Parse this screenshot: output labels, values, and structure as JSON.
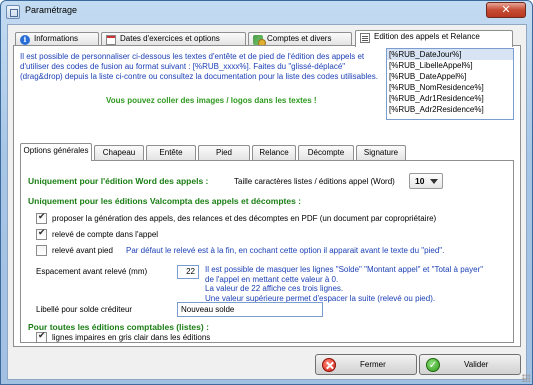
{
  "window": {
    "title": "Paramétrage",
    "close_symbol": "✕"
  },
  "top_tabs": [
    {
      "label": "Informations",
      "icon": "info-icon"
    },
    {
      "label": "Dates d'exercices et options",
      "icon": "calendar-icon"
    },
    {
      "label": "Comptes et divers",
      "icon": "accounts-icon"
    },
    {
      "label": "Edition des appels et Relance",
      "icon": "edition-icon"
    }
  ],
  "intro_text": "Il est possible de personnaliser ci-dessous les textes d'entête et de pied de l'édition des appels et d'utiliser des codes de fusion au format suivant : [%RUB_xxxx%]. Faites du \"glissé-déplacé\" (drag&drop) depuis la liste ci-contre ou consultez la documentation pour la liste des codes utilisables.",
  "paste_note": "Vous pouvez coller des images / logos dans les textes !",
  "merge_codes": [
    "[%RUB_DateJour%]",
    "[%RUB_LibelleAppel%]",
    "[%RUB_DateAppel%]",
    "[%RUB_NomResidence%]",
    "[%RUB_Adr1Residence%]",
    "[%RUB_Adr2Residence%]"
  ],
  "inner_tabs": [
    "Options générales",
    "Chapeau",
    "Entête",
    "Pied",
    "Relance",
    "Décompte",
    "Signature"
  ],
  "options": {
    "word_section": "Uniquement pour l'édition Word des appels :",
    "font_size_label": "Taille caractères listes / éditions appel (Word)",
    "font_size_value": "10",
    "valcompta_section": "Uniquement pour les éditions Valcompta des appels et décomptes :",
    "pdf_option": "proposer la génération des appels, des relances et des décomptes en PDF (un document par copropriétaire)",
    "pdf_checked": true,
    "releve_option": "relevé de compte dans l'appel",
    "releve_checked": true,
    "releve_avant_option": "relevé avant pied",
    "releve_avant_checked": false,
    "releve_avant_note": "Par défaut le relevé est à la fin, en cochant cette option il apparait avant le texte du \"pied\".",
    "spacing_label": "Espacement avant relevé (mm)",
    "spacing_value": "22",
    "spacing_note": [
      "Il est possible de masquer les lignes \"Solde\" \"Montant appel\" et \"Total à payer\"",
      "de l'appel en mettant cette valeur à 0.",
      "La valeur de 22 affiche ces trois lignes.",
      "Une valeur supérieure permet d'espacer la suite (relevé ou pied)."
    ],
    "credit_label": "Libellé pour solde créditeur",
    "credit_value": "Nouveau solde",
    "all_section": "Pour toutes les éditions comptables (listes) :",
    "grey_lines_option": "lignes impaires en gris clair dans les éditions",
    "grey_lines_checked": true
  },
  "buttons": {
    "close": "Fermer",
    "validate": "Valider"
  }
}
